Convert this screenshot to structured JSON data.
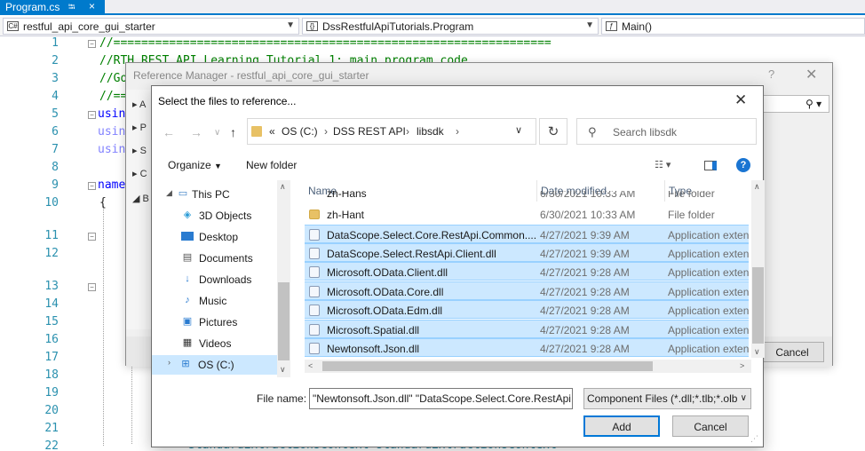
{
  "editor": {
    "tab_title": "Program.cs",
    "tab_pin": "⭾",
    "tab_close": "×",
    "nav_project": "restful_api_core_gui_starter",
    "nav_class": "DssRestfulApiTutorials.Program",
    "nav_member": "Main()",
    "line_numbers": [
      "1",
      "2",
      "3",
      "4",
      "5",
      "6",
      "7",
      "8",
      "9",
      "10",
      "11",
      "12",
      "13",
      "14",
      "15",
      "16",
      "17",
      "18",
      "19",
      "20",
      "21",
      "22"
    ],
    "code_line1": "//===============================================================",
    "code_line2": "//RTH REST API Learning Tutorial 1: main program code",
    "code_line3": "//Go",
    "code_line4": "//==",
    "using1": "usin",
    "using2": "usin",
    "using3": "usin",
    "namespace_kw": "name",
    "brace": "{",
    "bottom_code": "StandardExtractionsContext standardExtractionsContext ="
  },
  "reference_manager": {
    "title": "Reference Manager - restful_api_core_gui_starter",
    "help": "?",
    "close": "✕",
    "side_letters": [
      "A",
      "P",
      "S",
      "C",
      "B"
    ],
    "cancel_label": "Cancel"
  },
  "file_dialog": {
    "title": "Select the files to reference...",
    "close": "✕",
    "address": {
      "prefix": "«",
      "crumbs": [
        "OS (C:)",
        "DSS REST API",
        "libsdk"
      ]
    },
    "search_placeholder": "Search libsdk",
    "toolbar": {
      "organize": "Organize",
      "new_folder": "New folder"
    },
    "nav_items": [
      {
        "label": "This PC",
        "icon": "computer-icon"
      },
      {
        "label": "3D Objects",
        "icon": "cube-icon"
      },
      {
        "label": "Desktop",
        "icon": "desktop-icon"
      },
      {
        "label": "Documents",
        "icon": "document-icon"
      },
      {
        "label": "Downloads",
        "icon": "download-icon"
      },
      {
        "label": "Music",
        "icon": "music-icon"
      },
      {
        "label": "Pictures",
        "icon": "picture-icon"
      },
      {
        "label": "Videos",
        "icon": "video-icon"
      },
      {
        "label": "OS (C:)",
        "icon": "drive-icon"
      }
    ],
    "columns": {
      "name": "Name",
      "date_modified": "Date modified",
      "type": "Type"
    },
    "partial_row": {
      "name": "zh-Hans",
      "date": "6/30/2021 10:33 AM",
      "type": "File folder"
    },
    "files": [
      {
        "name": "zh-Hant",
        "date": "6/30/2021 10:33 AM",
        "type": "File folder",
        "kind": "folder",
        "selected": false
      },
      {
        "name": "DataScope.Select.Core.RestApi.Common....",
        "date": "4/27/2021 9:39 AM",
        "type": "Application exten",
        "kind": "dll",
        "selected": true
      },
      {
        "name": "DataScope.Select.RestApi.Client.dll",
        "date": "4/27/2021 9:39 AM",
        "type": "Application exten",
        "kind": "dll",
        "selected": true
      },
      {
        "name": "Microsoft.OData.Client.dll",
        "date": "4/27/2021 9:28 AM",
        "type": "Application exten",
        "kind": "dll",
        "selected": true
      },
      {
        "name": "Microsoft.OData.Core.dll",
        "date": "4/27/2021 9:28 AM",
        "type": "Application exten",
        "kind": "dll",
        "selected": true
      },
      {
        "name": "Microsoft.OData.Edm.dll",
        "date": "4/27/2021 9:28 AM",
        "type": "Application exten",
        "kind": "dll",
        "selected": true
      },
      {
        "name": "Microsoft.Spatial.dll",
        "date": "4/27/2021 9:28 AM",
        "type": "Application exten",
        "kind": "dll",
        "selected": true
      },
      {
        "name": "Newtonsoft.Json.dll",
        "date": "4/27/2021 9:28 AM",
        "type": "Application exten",
        "kind": "dll",
        "selected": true
      }
    ],
    "file_name_label": "File name:",
    "file_name_value": "\"Newtonsoft.Json.dll\" \"DataScope.Select.Core.RestApi",
    "file_type_value": "Component Files (*.dll;*.tlb;*.olb",
    "add_label": "Add",
    "cancel_label": "Cancel"
  },
  "colors": {
    "accent": "#007acc",
    "selection": "#cce8ff",
    "help_icon": "#1a75d2"
  }
}
